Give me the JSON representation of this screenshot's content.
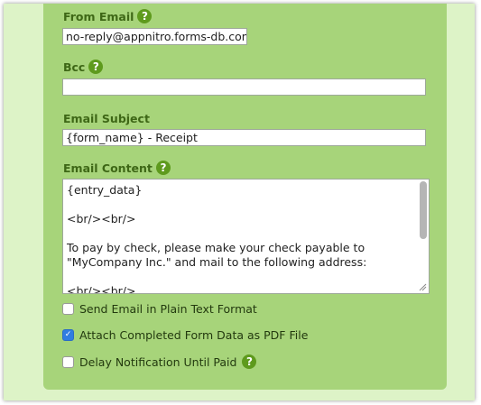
{
  "from_email": {
    "label": "From Email",
    "value": "no-reply@appnitro.forms-db.com"
  },
  "bcc": {
    "label": "Bcc",
    "value": ""
  },
  "email_subject": {
    "label": "Email Subject",
    "value": "{form_name} - Receipt"
  },
  "email_content": {
    "label": "Email Content",
    "value": "{entry_data}\n\n<br/><br/>\n\nTo pay by check, please make your check payable to \"MyCompany Inc.\" and mail to the following address:\n\n<br/><br/>"
  },
  "options": [
    {
      "label": "Send Email in Plain Text Format",
      "checked": false
    },
    {
      "label": "Attach Completed Form Data as PDF File",
      "checked": true
    },
    {
      "label": "Delay Notification Until Paid",
      "checked": false
    }
  ],
  "help_glyph": "?",
  "check_glyph": "✓"
}
